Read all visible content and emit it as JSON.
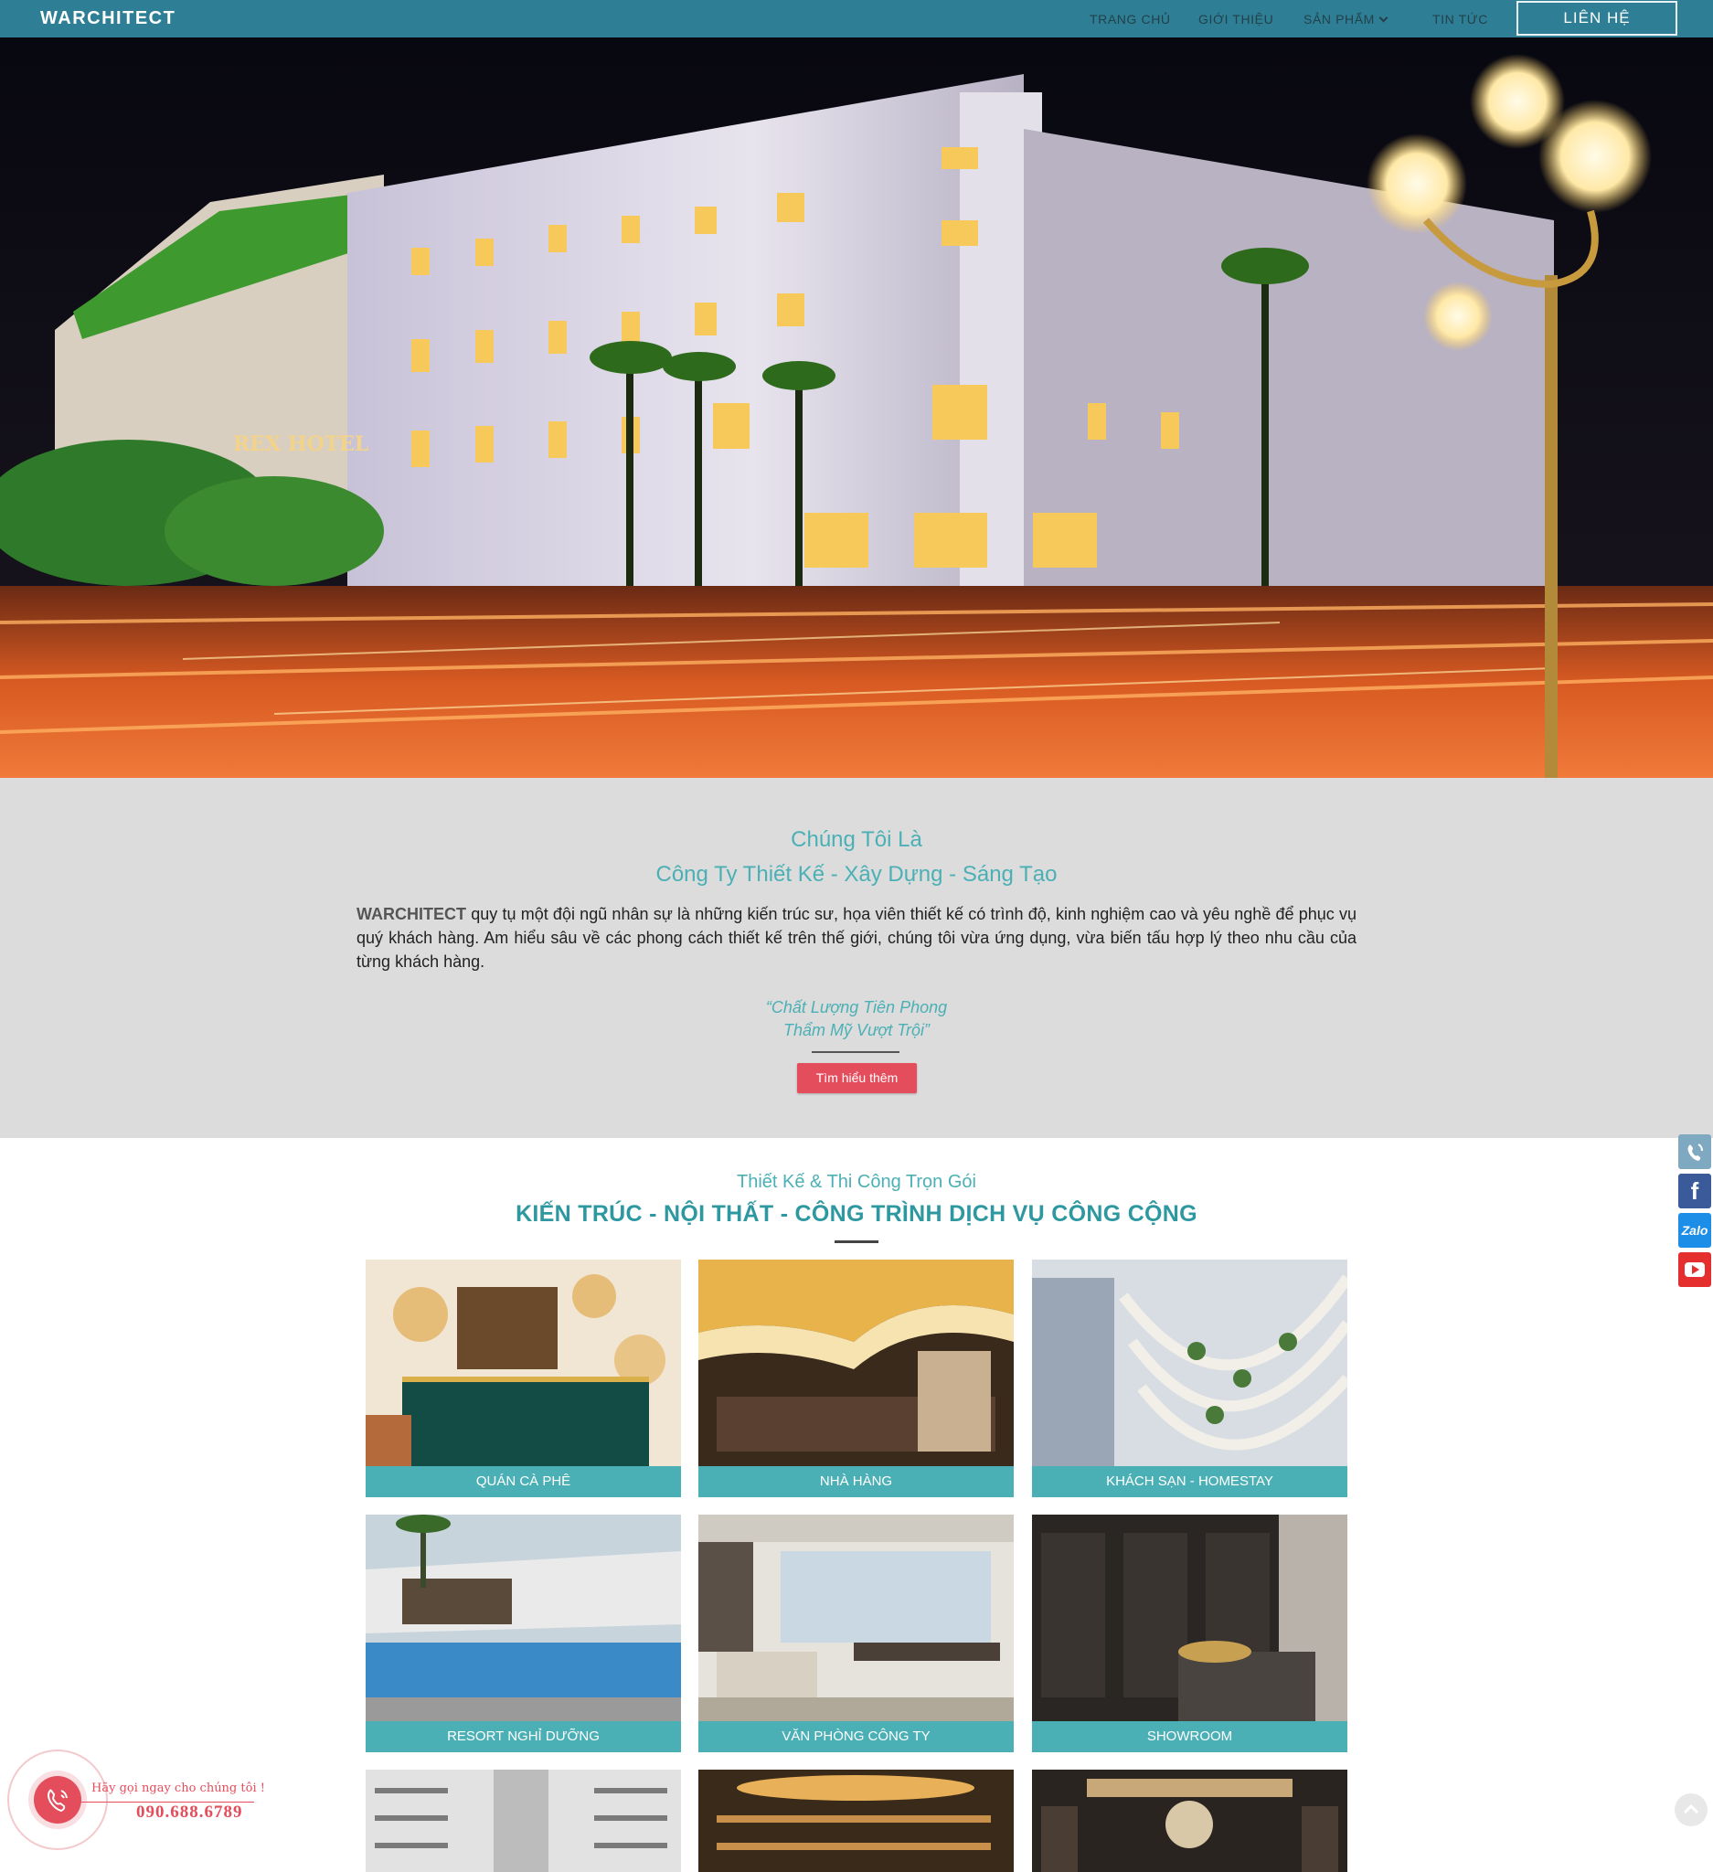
{
  "nav": {
    "logo": "WARCHITECT",
    "items": [
      {
        "label": "TRANG CHỦ"
      },
      {
        "label": "GIỚI THIỆU"
      },
      {
        "label": "SẢN PHẨM"
      },
      {
        "label": "TIN TỨC"
      }
    ],
    "contact_label": "LIÊN HỆ"
  },
  "hero": {
    "sign_text": "REX HOTEL"
  },
  "about": {
    "heading_line1": "Chúng Tôi Là",
    "heading_line2": "Công Ty Thiết Kế - Xây Dựng - Sáng Tạo",
    "brand": "WARCHITECT",
    "body": " quy tụ một đội ngũ nhân sự là những kiến trúc sư, họa viên thiết kế có trình độ, kinh nghiệm cao và yêu nghề để phục vụ quý khách hàng. Am hiểu sâu về các phong cách thiết kế trên thế giới, chúng tôi vừa ứng dụng, vừa biến tấu hợp lý theo nhu cầu của từng khách hàng.",
    "quote_line1": "“Chất Lượng Tiên Phong",
    "quote_line2": "Thẩm Mỹ Vượt Trội”",
    "button_label": "Tìm hiểu thêm"
  },
  "services": {
    "subtitle": "Thiết Kế & Thi Công Trọn Gói",
    "title": "KIẾN TRÚC - NỘI THẤT - CÔNG TRÌNH DỊCH VỤ CÔNG CỘNG",
    "cards": [
      {
        "label": "QUÁN CÀ PHÊ"
      },
      {
        "label": "NHÀ HÀNG"
      },
      {
        "label": "KHÁCH SẠN - HOMESTAY"
      },
      {
        "label": "RESORT NGHỈ DƯỠNG"
      },
      {
        "label": "VĂN PHÒNG CÔNG TY"
      },
      {
        "label": "SHOWROOM"
      }
    ]
  },
  "social": [
    {
      "icon": "phone-icon",
      "color": "#7fa9c0"
    },
    {
      "icon": "facebook-icon",
      "label": "f",
      "color": "#3a5a9a"
    },
    {
      "icon": "zalo-icon",
      "label": "Zalo",
      "color": "#1c8ee8"
    },
    {
      "icon": "youtube-icon",
      "color": "#e52e2e"
    }
  ],
  "call_widget": {
    "text": "Hãy gọi ngay cho chúng tôi !",
    "phone": "090.688.6789"
  },
  "colors": {
    "nav": "#2e7f95",
    "accent": "#4bb0b5",
    "button": "#e44d5c",
    "about_bg": "#dcdcdc"
  }
}
